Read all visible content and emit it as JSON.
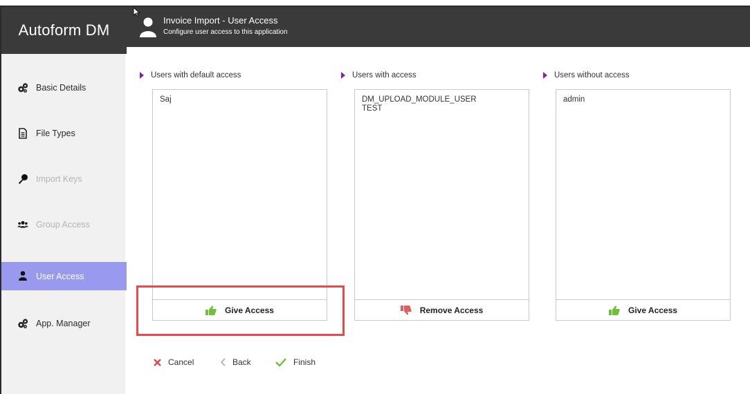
{
  "app": {
    "brand": "Autoform DM"
  },
  "header": {
    "title": "Invoice Import - User Access",
    "subtitle": "Configure user access to this application",
    "icon": "user-icon"
  },
  "sidebar": {
    "items": [
      {
        "label": "Basic Details",
        "icon": "cogs-icon",
        "state": "normal"
      },
      {
        "label": "File Types",
        "icon": "document-icon",
        "state": "normal"
      },
      {
        "label": "Import Keys",
        "icon": "key-icon",
        "state": "disabled"
      },
      {
        "label": "Group Access",
        "icon": "users-icon",
        "state": "disabled"
      },
      {
        "label": "User Access",
        "icon": "user-icon",
        "state": "active"
      },
      {
        "label": "App. Manager",
        "icon": "cogs-icon",
        "state": "normal"
      }
    ]
  },
  "columns": [
    {
      "title": "Users with default access",
      "users": [
        "Saj"
      ],
      "action": "Give Access",
      "action_icon": "thumbs-up-icon"
    },
    {
      "title": "Users with access",
      "users": [
        "DM_UPLOAD_MODULE_USER",
        "TEST"
      ],
      "action": "Remove Access",
      "action_icon": "thumbs-down-icon"
    },
    {
      "title": "Users without access",
      "users": [
        "admin"
      ],
      "action": "Give Access",
      "action_icon": "thumbs-up-icon"
    }
  ],
  "footer": {
    "cancel": "Cancel",
    "back": "Back",
    "finish": "Finish"
  },
  "colors": {
    "accent_active": "#9999ee",
    "header_bg": "#3a3a3a",
    "marker": "#8b1fb0",
    "thumb_up": "#6fbf3a",
    "thumb_down": "#e06060",
    "cancel": "#e04545",
    "finish": "#6fbf3a",
    "highlight": "#e84a4a"
  }
}
